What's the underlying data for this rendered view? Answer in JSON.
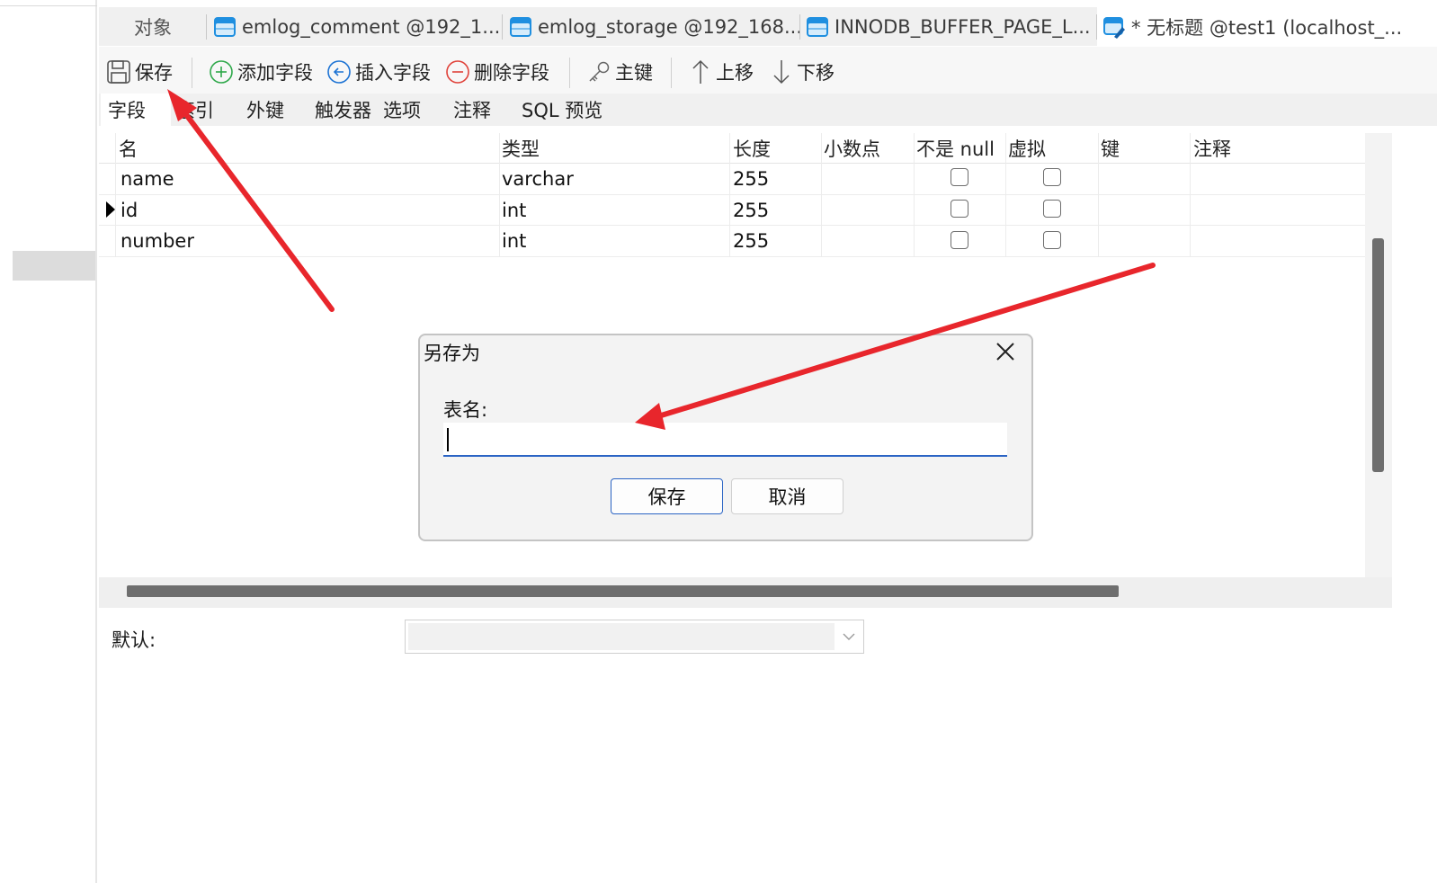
{
  "tabs": [
    {
      "label": "对象",
      "icon": "none"
    },
    {
      "label": "emlog_comment @192_1...",
      "icon": "table-icon"
    },
    {
      "label": "emlog_storage @192_168...",
      "icon": "table-icon"
    },
    {
      "label": "INNODB_BUFFER_PAGE_L...",
      "icon": "table-icon"
    },
    {
      "label": "* 无标题 @test1 (localhost_...",
      "icon": "table-design-icon"
    }
  ],
  "toolbar": {
    "save": "保存",
    "add_field": "添加字段",
    "insert_field": "插入字段",
    "delete_field": "删除字段",
    "primary_key": "主键",
    "move_up": "上移",
    "move_down": "下移"
  },
  "subtabs": [
    "字段",
    "索引",
    "外键",
    "触发器",
    "选项",
    "注释",
    "SQL 预览"
  ],
  "grid": {
    "columns": [
      "名",
      "类型",
      "长度",
      "小数点",
      "不是 null",
      "虚拟",
      "键",
      "注释"
    ],
    "rows": [
      {
        "name": "name",
        "type": "varchar",
        "length": "255",
        "decimals": "",
        "not_null": false,
        "virtual": false,
        "key": "",
        "comment": "",
        "current": false
      },
      {
        "name": "id",
        "type": "int",
        "length": "255",
        "decimals": "",
        "not_null": false,
        "virtual": false,
        "key": "",
        "comment": "",
        "current": true
      },
      {
        "name": "number",
        "type": "int",
        "length": "255",
        "decimals": "",
        "not_null": false,
        "virtual": false,
        "key": "",
        "comment": "",
        "current": false
      }
    ]
  },
  "bottom": {
    "default_label": "默认:",
    "default_value": ""
  },
  "dialog": {
    "title": "另存为",
    "field_label": "表名:",
    "field_value": "",
    "save_label": "保存",
    "cancel_label": "取消"
  },
  "colors": {
    "accent": "#2b64c4",
    "arrow": "#e8262c",
    "scroll_thumb": "#6e6e6e"
  }
}
